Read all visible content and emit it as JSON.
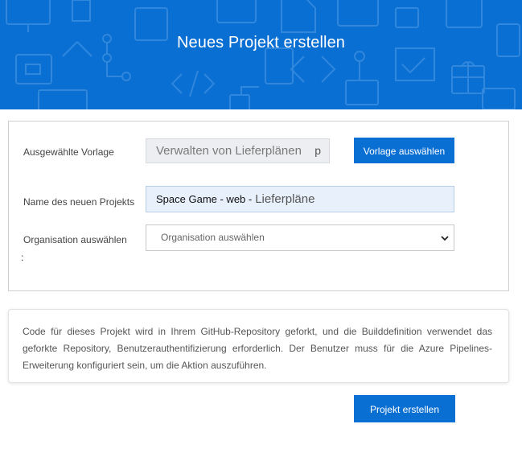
{
  "header": {
    "title": "Neues Projekt erstellen"
  },
  "form": {
    "template_label": "Ausgewählte Vorlage",
    "template_value": "Verwalten von Lieferplänen",
    "template_value_suffix": "p",
    "select_template_button": "Vorlage auswählen",
    "project_name_label": "Name des neuen Projekts",
    "project_name_prefix": "Space Game - web -",
    "project_name_value": "Lieferpläne",
    "organization_label": "Organisation auswählen",
    "organization_selected": "Organisation auswählen",
    "organization_options": [
      "Organisation auswählen"
    ],
    "stray_colon": ":"
  },
  "info": {
    "text": "Code für dieses Projekt wird in Ihrem GitHub-Repository geforkt, und die Builddefinition verwendet das geforkte Repository, Benutzerauthentifizierung erforderlich. Der Benutzer muss für die Azure Pipelines-Erweiterung konfiguriert sein, um die Aktion auszuführen."
  },
  "actions": {
    "create_project_button": "Projekt erstellen"
  },
  "colors": {
    "brand_blue": "#0a6fd2",
    "pattern_stroke": "#3d8fe0",
    "name_field_bg": "#e7f0fb",
    "readonly_field_bg": "#eceef1"
  }
}
